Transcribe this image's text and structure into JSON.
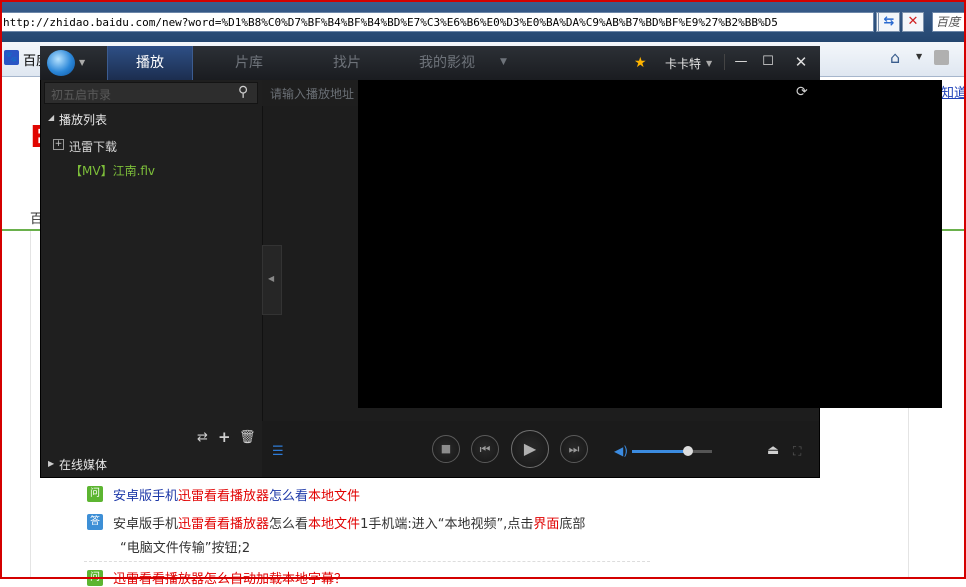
{
  "browser": {
    "url": "http://zhidao.baidu.com/new?word=%D1%B8%C0%D7%BF%B4%BF%B4%BD%E7%C3%E6%B6%E0%D3%E0%BA%DA%C9%AB%B7%BD%BF%E9%27%B2%BB%D5",
    "search_text": "百度",
    "favorites_label": "百度",
    "right_link": "知道"
  },
  "page": {
    "logo_letter": "B",
    "nav_text": "百",
    "qa": [
      {
        "tag": "问",
        "segments": [
          {
            "t": "安卓版手机",
            "c": "blue"
          },
          {
            "t": "迅雷看看播放器",
            "c": "hl"
          },
          {
            "t": "怎么看",
            "c": "blue"
          },
          {
            "t": "本地文件",
            "c": "hl"
          }
        ]
      },
      {
        "tag": "答",
        "segments": [
          {
            "t": "安卓版手机",
            "c": "n"
          },
          {
            "t": "迅雷看看播放器",
            "c": "hl"
          },
          {
            "t": "怎么看",
            "c": "n"
          },
          {
            "t": "本地文件",
            "c": "hl"
          },
          {
            "t": "1手机端:进入“本地视频”,点击",
            "c": "n"
          },
          {
            "t": "界面",
            "c": "hl"
          },
          {
            "t": "底部",
            "c": "n"
          }
        ],
        "line2": "“电脑文件传输”按钮;2"
      },
      {
        "tag": "问",
        "segments": [
          {
            "t": "迅雷看看播放器",
            "c": "hl"
          },
          {
            "t": "怎么自动加载本地字幕？",
            "c": "hl"
          }
        ]
      }
    ]
  },
  "player": {
    "tabs": [
      "播放",
      "片库",
      "找片",
      "我的影视"
    ],
    "active_tab": 0,
    "username": "卡卡特",
    "search_placeholder": "初五启市录",
    "playlist_title": "播放列表",
    "folder_label": "迅雷下载",
    "playlist_item": "【MV】江南.flv",
    "address_placeholder": "请输入播放地址",
    "online_media": "在线媒体",
    "volume_level": 0.7,
    "accent_color": "#2e7bd6",
    "item_color": "#7dbf3a"
  }
}
